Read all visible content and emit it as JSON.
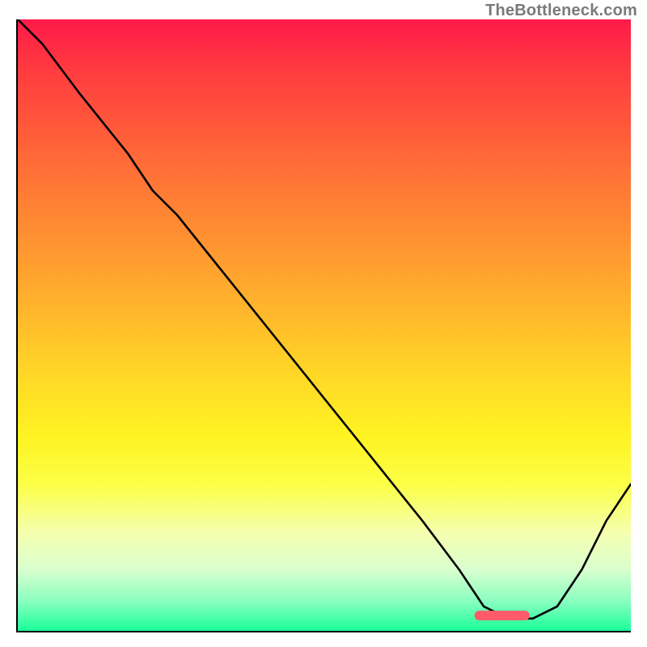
{
  "watermark": "TheBottleneck.com",
  "chart_data": {
    "type": "line",
    "title": "",
    "xlabel": "",
    "ylabel": "",
    "xlim": [
      0,
      100
    ],
    "ylim": [
      0,
      100
    ],
    "series": [
      {
        "name": "curve",
        "x": [
          0,
          4,
          10,
          18,
          22,
          26,
          34,
          42,
          50,
          58,
          66,
          72,
          76,
          80,
          84,
          88,
          92,
          96,
          100
        ],
        "values": [
          100,
          96,
          88,
          78,
          72,
          68,
          58,
          48,
          38,
          28,
          18,
          10,
          4,
          2,
          2,
          4,
          10,
          18,
          24
        ]
      }
    ],
    "marker": {
      "x_center": 79,
      "y": 2.5,
      "width": 9,
      "color": "#ff5a6a"
    },
    "gradient_stops": [
      {
        "pos": 0,
        "color": "#ff1a4a"
      },
      {
        "pos": 8,
        "color": "#ff3a3f"
      },
      {
        "pos": 18,
        "color": "#ff5a3a"
      },
      {
        "pos": 28,
        "color": "#ff7a35"
      },
      {
        "pos": 38,
        "color": "#ff9830"
      },
      {
        "pos": 48,
        "color": "#ffb82b"
      },
      {
        "pos": 58,
        "color": "#ffd726"
      },
      {
        "pos": 68,
        "color": "#fff322"
      },
      {
        "pos": 76,
        "color": "#fbff45"
      },
      {
        "pos": 84,
        "color": "#f5ffb0"
      },
      {
        "pos": 90,
        "color": "#d9ffcf"
      },
      {
        "pos": 95,
        "color": "#8cffc0"
      },
      {
        "pos": 100,
        "color": "#1aff9a"
      }
    ]
  }
}
